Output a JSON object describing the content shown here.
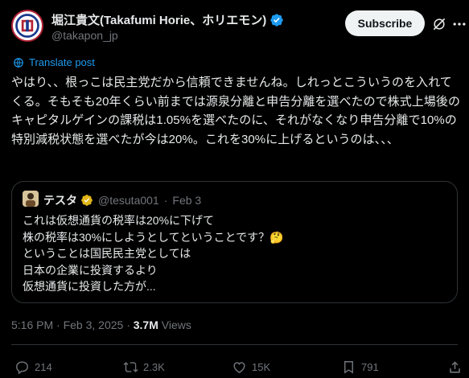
{
  "author": {
    "name": "堀江貴文(Takafumi Horie、ホリエモン)",
    "handle": "@takapon_jp"
  },
  "header": {
    "subscribe_label": "Subscribe"
  },
  "translate_label": "Translate post",
  "post": {
    "text": "やはり、、根っこは民主党だから信頼できませんね。しれっとこういうのを入れてくる。そもそも20年くらい前までは源泉分離と申告分離を選べたので株式上場後のキャピタルゲインの課税は1.05%を選べたのに、それがなくなり申告分離で10%の特別減税状態を選べたが今は20%。これを30%に上げるというのは、、、"
  },
  "quote": {
    "name": "テスタ",
    "handle": "@tesuta001",
    "date": "Feb 3",
    "text": "これは仮想通貨の税率は20%に下げて\n株の税率は30%にしようとしてということです？🤔\nということは国民民主党としては\n日本の企業に投資するより\n仮想通貨に投資した方が..."
  },
  "meta": {
    "time": "5:16 PM · Feb 3, 2025 · ",
    "views_count": "3.7M",
    "views_label": " Views"
  },
  "actions": {
    "replies": "214",
    "reposts": "2.3K",
    "likes": "15K",
    "bookmarks": "791"
  },
  "colors": {
    "accent": "#1d9bf0",
    "gold_badge": "#e2b719",
    "muted": "#71767b"
  }
}
